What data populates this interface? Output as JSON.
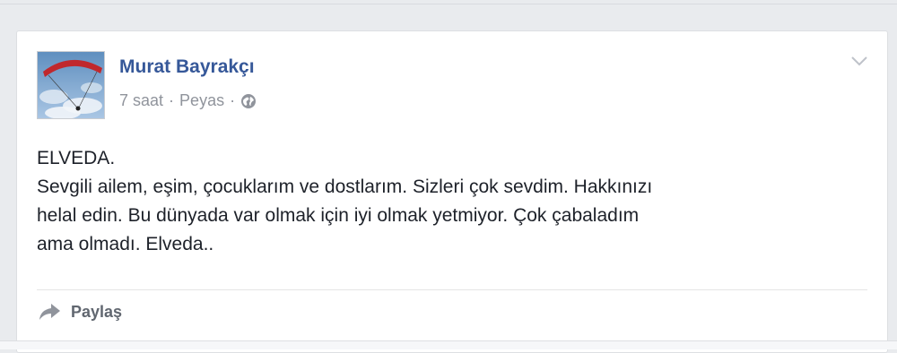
{
  "post": {
    "author": "Murat Bayrakçı",
    "time": "7 saat",
    "location": "Peyas",
    "separator": "·",
    "text_lines": [
      "ELVEDA.",
      "Sevgili ailem, eşim, çocuklarım ve dostlarım. Sizleri çok sevdim. Hakkınızı",
      "helal edin. Bu dünyada var olmak için iyi olmak yetmiyor. Çok çabaladım",
      "ama olmadı. Elveda.."
    ],
    "privacy_icon": "globe-icon",
    "options_icon": "chevron-down-icon"
  },
  "actions": {
    "share_label": "Paylaş",
    "share_icon": "share-arrow-icon"
  },
  "colors": {
    "author_link": "#365899",
    "meta_text": "#90949c",
    "body_text": "#1d2129",
    "page_background": "#e9ebee"
  }
}
